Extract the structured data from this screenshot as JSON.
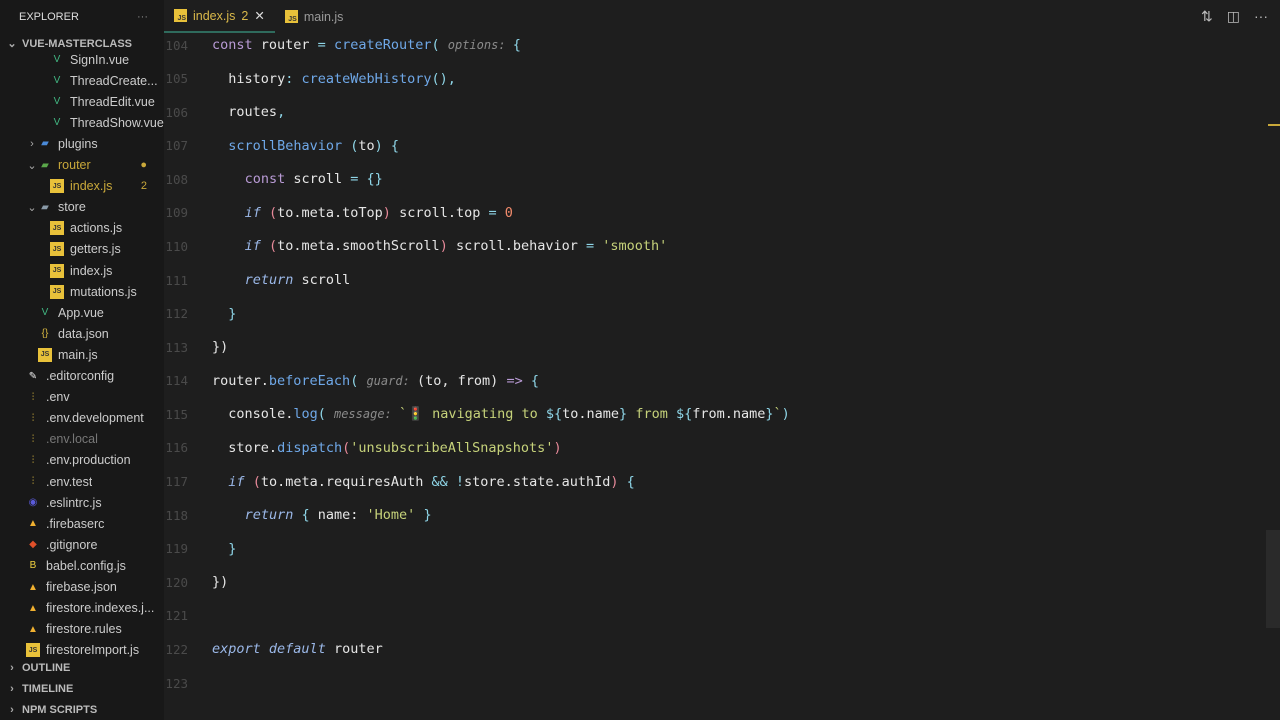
{
  "sidebar": {
    "title": "EXPLORER",
    "more": "···",
    "project": "VUE-MASTERCLASS",
    "items": [
      {
        "label": "SignIn.vue",
        "icon": "vue",
        "indent": 3
      },
      {
        "label": "ThreadCreate...",
        "icon": "vue",
        "indent": 3
      },
      {
        "label": "ThreadEdit.vue",
        "icon": "vue",
        "indent": 3
      },
      {
        "label": "ThreadShow.vue",
        "icon": "vue",
        "indent": 3
      },
      {
        "label": "plugins",
        "icon": "folder-plugins",
        "indent": 2,
        "chevron": "›"
      },
      {
        "label": "router",
        "icon": "folder-router",
        "indent": 2,
        "chevron": "⌄",
        "badge": "●",
        "color": "#c9a83a"
      },
      {
        "label": "index.js",
        "icon": "js",
        "indent": 3,
        "badge": "2",
        "color": "#c9a83a"
      },
      {
        "label": "store",
        "icon": "folder",
        "indent": 2,
        "chevron": "⌄"
      },
      {
        "label": "actions.js",
        "icon": "js",
        "indent": 3
      },
      {
        "label": "getters.js",
        "icon": "js",
        "indent": 3
      },
      {
        "label": "index.js",
        "icon": "js",
        "indent": 3
      },
      {
        "label": "mutations.js",
        "icon": "js",
        "indent": 3
      },
      {
        "label": "App.vue",
        "icon": "vue",
        "indent": 2
      },
      {
        "label": "data.json",
        "icon": "json",
        "indent": 2
      },
      {
        "label": "main.js",
        "icon": "js",
        "indent": 2
      },
      {
        "label": ".editorconfig",
        "icon": "editorconfig",
        "indent": 1
      },
      {
        "label": ".env",
        "icon": "env",
        "indent": 1
      },
      {
        "label": ".env.development",
        "icon": "env",
        "indent": 1
      },
      {
        "label": ".env.local",
        "icon": "env",
        "indent": 1,
        "color": "#777"
      },
      {
        "label": ".env.production",
        "icon": "env",
        "indent": 1
      },
      {
        "label": ".env.test",
        "icon": "env",
        "indent": 1
      },
      {
        "label": ".eslintrc.js",
        "icon": "eslint",
        "indent": 1
      },
      {
        "label": ".firebaserc",
        "icon": "firebase",
        "indent": 1
      },
      {
        "label": ".gitignore",
        "icon": "git",
        "indent": 1
      },
      {
        "label": "babel.config.js",
        "icon": "babel",
        "indent": 1
      },
      {
        "label": "firebase.json",
        "icon": "firebase",
        "indent": 1
      },
      {
        "label": "firestore.indexes.j...",
        "icon": "firebase",
        "indent": 1
      },
      {
        "label": "firestore.rules",
        "icon": "firebase",
        "indent": 1
      },
      {
        "label": "firestoreImport.js",
        "icon": "js",
        "indent": 1
      }
    ],
    "sections": [
      "OUTLINE",
      "TIMELINE",
      "NPM SCRIPTS"
    ]
  },
  "tabs": [
    {
      "label": "index.js",
      "badge": "2",
      "close": "✕",
      "active": true
    },
    {
      "label": "main.js",
      "active": false
    }
  ],
  "editor": {
    "lines": [
      {
        "n": "104",
        "i": 0,
        "t": [
          [
            "const",
            "kw"
          ],
          [
            " router ",
            "plain"
          ],
          [
            "=",
            "pn"
          ],
          [
            " createRouter",
            "fn"
          ],
          [
            "( ",
            "pn"
          ],
          [
            "options: ",
            "hint"
          ],
          [
            "{",
            "pn"
          ]
        ]
      },
      {
        "n": "105",
        "i": 1,
        "t": [
          [
            "history",
            "plain"
          ],
          [
            ": ",
            "pn"
          ],
          [
            "createWebHistory",
            "fn"
          ],
          [
            "(),",
            "pn"
          ]
        ]
      },
      {
        "n": "106",
        "i": 1,
        "t": [
          [
            "routes",
            "plain"
          ],
          [
            ",",
            "pn"
          ]
        ]
      },
      {
        "n": "107",
        "i": 1,
        "t": [
          [
            "scrollBehavior",
            "fn"
          ],
          [
            " (",
            "pn"
          ],
          [
            "to",
            "plain"
          ],
          [
            ") {",
            "pn"
          ]
        ]
      },
      {
        "n": "108",
        "i": 2,
        "t": [
          [
            "const",
            "kw"
          ],
          [
            " scroll ",
            "plain"
          ],
          [
            "= {}",
            "pn"
          ]
        ]
      },
      {
        "n": "109",
        "i": 2,
        "t": [
          [
            "if",
            "kwi"
          ],
          [
            " (",
            "par"
          ],
          [
            "to.meta.toTop",
            "plain"
          ],
          [
            ")",
            "par"
          ],
          [
            " scroll.top ",
            "plain"
          ],
          [
            "= ",
            "pn"
          ],
          [
            "0",
            "num"
          ]
        ]
      },
      {
        "n": "110",
        "i": 2,
        "t": [
          [
            "if",
            "kwi"
          ],
          [
            " (",
            "par"
          ],
          [
            "to.meta.smoothScroll",
            "plain"
          ],
          [
            ")",
            "par"
          ],
          [
            " scroll.behavior ",
            "plain"
          ],
          [
            "= ",
            "pn"
          ],
          [
            "'smooth'",
            "str"
          ]
        ]
      },
      {
        "n": "111",
        "i": 2,
        "t": [
          [
            "return",
            "kwi"
          ],
          [
            " scroll",
            "plain"
          ]
        ]
      },
      {
        "n": "112",
        "i": 1,
        "t": [
          [
            "}",
            "pn"
          ]
        ]
      },
      {
        "n": "113",
        "i": 0,
        "t": [
          [
            "})",
            "plain"
          ]
        ]
      },
      {
        "n": "114",
        "i": 0,
        "t": [
          [
            "router.",
            "plain"
          ],
          [
            "beforeEach",
            "fn"
          ],
          [
            "( ",
            "pn"
          ],
          [
            "guard: ",
            "hint"
          ],
          [
            "(to, from) ",
            "plain"
          ],
          [
            "=>",
            "kw"
          ],
          [
            " {",
            "pn"
          ]
        ]
      },
      {
        "n": "115",
        "i": 1,
        "t": [
          [
            "console.",
            "plain"
          ],
          [
            "log",
            "fn"
          ],
          [
            "( ",
            "pn"
          ],
          [
            "message: ",
            "hint"
          ],
          [
            "`🚦 navigating to ",
            "str"
          ],
          [
            "${",
            "pn"
          ],
          [
            "to.name",
            "plain"
          ],
          [
            "}",
            "pn"
          ],
          [
            " from ",
            "str"
          ],
          [
            "${",
            "pn"
          ],
          [
            "from.name",
            "plain"
          ],
          [
            "}",
            "pn"
          ],
          [
            "`",
            "str"
          ],
          [
            ")",
            "pn"
          ]
        ]
      },
      {
        "n": "116",
        "i": 1,
        "t": [
          [
            "store.",
            "plain"
          ],
          [
            "dispatch",
            "fn"
          ],
          [
            "(",
            "par"
          ],
          [
            "'unsubscribeAllSnapshots'",
            "str"
          ],
          [
            ")",
            "par"
          ]
        ]
      },
      {
        "n": "117",
        "i": 1,
        "t": [
          [
            "if",
            "kwi"
          ],
          [
            " (",
            "par"
          ],
          [
            "to.meta.requiresAuth ",
            "plain"
          ],
          [
            "&&",
            "pn"
          ],
          [
            " !",
            "pn"
          ],
          [
            "store.state.authId",
            "plain"
          ],
          [
            ")",
            "par"
          ],
          [
            " {",
            "pn"
          ]
        ]
      },
      {
        "n": "118",
        "i": 2,
        "t": [
          [
            "return",
            "kwi"
          ],
          [
            " { ",
            "pn"
          ],
          [
            "name: ",
            "plain"
          ],
          [
            "'Home'",
            "str"
          ],
          [
            " }",
            "pn"
          ]
        ]
      },
      {
        "n": "119",
        "i": 1,
        "t": [
          [
            "}",
            "pn"
          ]
        ]
      },
      {
        "n": "120",
        "i": 0,
        "t": [
          [
            "})",
            "plain"
          ]
        ]
      },
      {
        "n": "121",
        "i": 0,
        "t": []
      },
      {
        "n": "122",
        "i": 0,
        "t": [
          [
            "export",
            "kwi"
          ],
          [
            " ",
            "plain"
          ],
          [
            "default",
            "kwi"
          ],
          [
            " router",
            "plain"
          ]
        ]
      },
      {
        "n": "123",
        "i": 0,
        "t": []
      }
    ]
  },
  "actions": [
    "source-control-icon",
    "split-editor-icon",
    "more-icon"
  ]
}
